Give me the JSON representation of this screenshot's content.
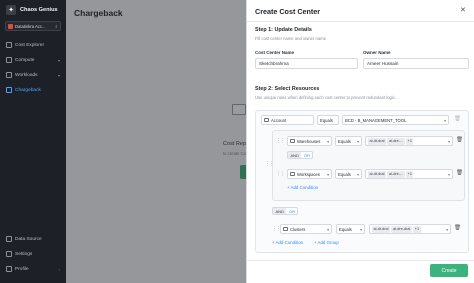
{
  "app": {
    "name": "Chaos Genius",
    "workspace": "Datatinkra Acc..."
  },
  "sidebar": {
    "items": [
      {
        "label": "Cost Explorer"
      },
      {
        "label": "Compute"
      },
      {
        "label": "Workloads"
      },
      {
        "label": "Chargeback"
      },
      {
        "label": "Data Source"
      },
      {
        "label": "Settings"
      },
      {
        "label": "Profile"
      }
    ]
  },
  "page": {
    "title": "Chargeback",
    "empty_title": "Cost Rep",
    "empty_sub": "to create Cost R"
  },
  "drawer": {
    "title": "Create Cost Center",
    "step1": {
      "title": "Step 1: Update Details",
      "hint": "Fill cost center name and owner name",
      "cost_center_label": "Cost Center Name",
      "cost_center_value": "Sketchbrahma",
      "owner_label": "Owner Name",
      "owner_value": "Ameer Hussain"
    },
    "step2": {
      "title": "Step 2: Select Resources",
      "hint": "Use unique rules when defining each cost center to prevent redundant logic.",
      "rule_root": {
        "field": "Account",
        "op": "Equals",
        "value": "BCD - B_MANAGEMENT_TOOL"
      },
      "group": {
        "rules": [
          {
            "field": "Warehouses",
            "op": "Equals",
            "tags": [
              "ai-dt-dral",
              "ai-dre-..."
            ],
            "more": "+1"
          },
          {
            "field": "Workspaces",
            "op": "Equals",
            "tags": [
              "ai-dt-dral",
              "ai-dre-..."
            ],
            "more": "+1"
          }
        ],
        "and_label": "AND",
        "or_label": "OR",
        "add_condition": "+ Add Condition"
      },
      "outer_and": "AND",
      "outer_or": "OR",
      "cluster_rule": {
        "field": "Clusters",
        "op": "Equals",
        "tags": [
          "ai-dt-dral",
          "ai-dre-dral"
        ],
        "more": "+1"
      },
      "add_condition": "+ Add Condition",
      "add_group": "+ Add Group"
    },
    "create_label": "Create"
  },
  "colors": {
    "accent": "#3bb37c",
    "link": "#2f8cf0",
    "sidebar": "#1d2127"
  }
}
